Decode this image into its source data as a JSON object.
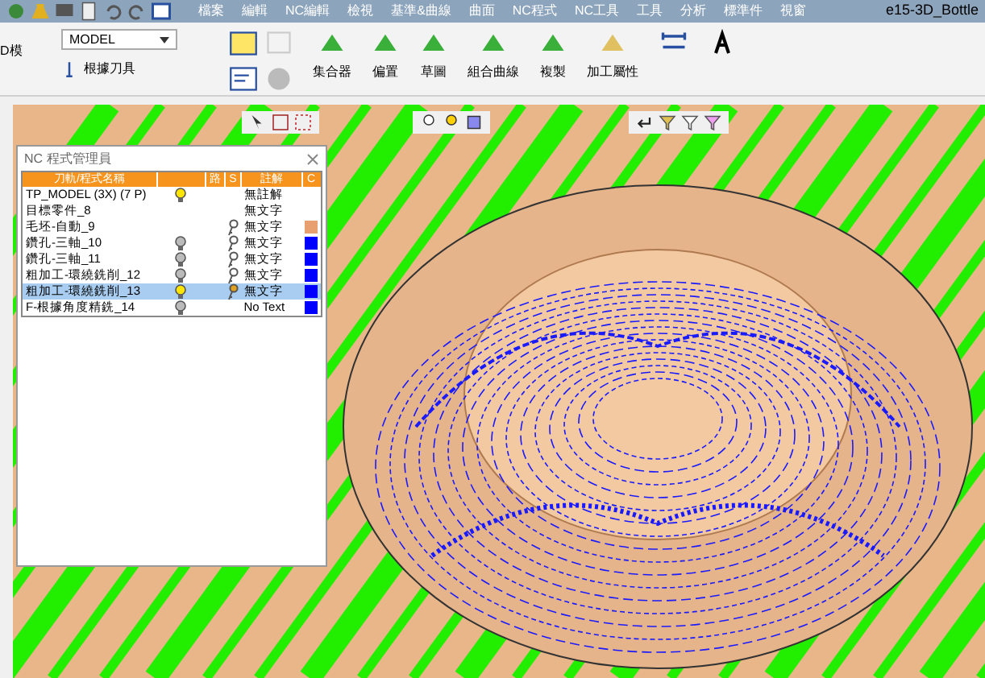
{
  "menu": [
    "檔案",
    "編輯",
    "NC編輯",
    "檢視",
    "基準&曲線",
    "曲面",
    "NC程式",
    "NC工具",
    "工具",
    "分析",
    "標準件",
    "視窗"
  ],
  "title": "e15-3D_Bottle",
  "ribbon": {
    "left_label": "D模",
    "model_select": "MODEL",
    "tool_label": "根據刀具",
    "labels": [
      "集合器",
      "偏置",
      "草圖",
      "組合曲線",
      "複製",
      "加工屬性"
    ]
  },
  "panel": {
    "title": "NC 程式管理員",
    "columns": [
      "刀軌/程式名稱",
      "路",
      "S",
      "註解",
      "C"
    ],
    "rows": [
      {
        "name": "TP_MODEL (3X) (7 P)",
        "lamp": true,
        "lit": true,
        "key": false,
        "note": "無註解",
        "selected": false
      },
      {
        "name": "目標零件_8",
        "lamp": false,
        "key": false,
        "note": "無文字",
        "selected": false
      },
      {
        "name": "毛坯-自動_9",
        "lamp": false,
        "key": true,
        "note": "無文字",
        "color": "#e9a071",
        "selected": false
      },
      {
        "name": "鑽孔-三軸_10",
        "lamp": true,
        "lit": false,
        "key": true,
        "note": "無文字",
        "color": "#0000ff",
        "selected": false
      },
      {
        "name": "鑽孔-三軸_11",
        "lamp": true,
        "lit": false,
        "key": true,
        "note": "無文字",
        "color": "#0000ff",
        "selected": false
      },
      {
        "name": "粗加工-環繞銑削_12",
        "lamp": true,
        "lit": false,
        "key": true,
        "note": "無文字",
        "color": "#0000ff",
        "selected": false
      },
      {
        "name": "粗加工-環繞銑削_13",
        "lamp": true,
        "lit": true,
        "key": true,
        "note": "無文字",
        "color": "#0000ff",
        "selected": true
      },
      {
        "name": "F-根據角度精銑_14",
        "lamp": true,
        "lit": false,
        "key": false,
        "note": "No Text",
        "color": "#0000ff",
        "selected": false
      }
    ]
  }
}
